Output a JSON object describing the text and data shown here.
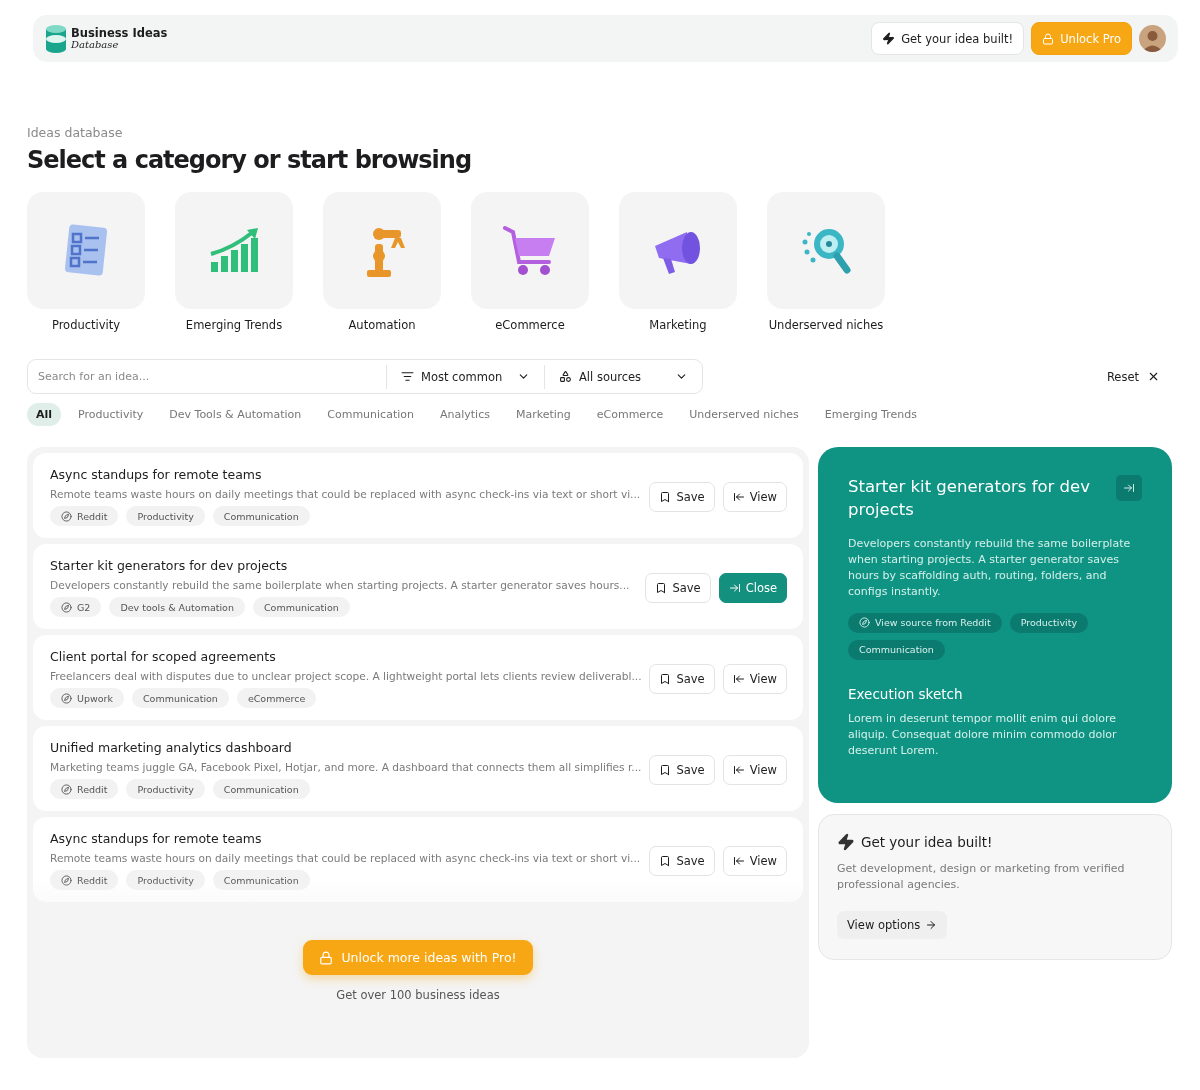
{
  "header": {
    "logo_title": "Business Ideas",
    "logo_subtitle": "Database",
    "build_button": "Get your idea built!",
    "pro_button": "Unlock Pro"
  },
  "eyebrow": "Ideas database",
  "title": "Select a category or start browsing",
  "categories": [
    {
      "label": "Productivity",
      "kind": "checklist"
    },
    {
      "label": "Emerging Trends",
      "kind": "chart"
    },
    {
      "label": "Automation",
      "kind": "robot"
    },
    {
      "label": "eCommerce",
      "kind": "cart"
    },
    {
      "label": "Marketing",
      "kind": "megaphone"
    },
    {
      "label": "Underserved niches",
      "kind": "magnifier"
    }
  ],
  "search": {
    "placeholder": "Search for an idea..."
  },
  "sort": "Most common",
  "sources": "All sources",
  "reset": "Reset",
  "filters": [
    {
      "label": "All",
      "selected": true
    },
    {
      "label": "Productivity",
      "selected": false
    },
    {
      "label": "Dev Tools & Automation",
      "selected": false
    },
    {
      "label": "Communication",
      "selected": false
    },
    {
      "label": "Analytics",
      "selected": false
    },
    {
      "label": "Marketing",
      "selected": false
    },
    {
      "label": "eCommerce",
      "selected": false
    },
    {
      "label": "Underserved niches",
      "selected": false
    },
    {
      "label": "Emerging Trends",
      "selected": false
    }
  ],
  "ideas": [
    {
      "title": "Async standups for remote teams",
      "description": "Remote teams waste hours on daily meetings that could be replaced with async check-ins via text or short vi...",
      "tags": [
        {
          "label": "Reddit",
          "kind": "source"
        },
        {
          "label": "Productivity",
          "kind": "topic"
        },
        {
          "label": "Communication",
          "kind": "topic"
        }
      ],
      "save": "Save",
      "action": "View",
      "selected": false
    },
    {
      "title": "Starter kit generators for dev projects",
      "description": "Developers constantly rebuild the same boilerplate when starting projects. A starter generator saves hours...",
      "tags": [
        {
          "label": "G2",
          "kind": "source"
        },
        {
          "label": "Dev tools & Automation",
          "kind": "topic"
        },
        {
          "label": "Communication",
          "kind": "topic"
        }
      ],
      "save": "Save",
      "action": "Close",
      "selected": true
    },
    {
      "title": "Client portal for scoped agreements",
      "description": "Freelancers deal with disputes due to unclear project scope. A lightweight portal lets clients review deliverabl...",
      "tags": [
        {
          "label": "Upwork",
          "kind": "source"
        },
        {
          "label": "Communication",
          "kind": "topic"
        },
        {
          "label": "eCommerce",
          "kind": "topic"
        }
      ],
      "save": "Save",
      "action": "View",
      "selected": false
    },
    {
      "title": "Unified marketing analytics dashboard",
      "description": "Marketing teams juggle GA, Facebook Pixel, Hotjar, and more. A dashboard that connects them all simplifies r...",
      "tags": [
        {
          "label": "Reddit",
          "kind": "source"
        },
        {
          "label": "Productivity",
          "kind": "topic"
        },
        {
          "label": "Communication",
          "kind": "topic"
        }
      ],
      "save": "Save",
      "action": "View",
      "selected": false
    },
    {
      "title": "Async standups for remote teams",
      "description": "Remote teams waste hours on daily meetings that could be replaced with async check-ins via text or short vi...",
      "tags": [
        {
          "label": "Reddit",
          "kind": "source"
        },
        {
          "label": "Productivity",
          "kind": "topic"
        },
        {
          "label": "Communication",
          "kind": "topic"
        }
      ],
      "save": "Save",
      "action": "View",
      "selected": false
    }
  ],
  "unlock": {
    "button": "Unlock more ideas with Pro!",
    "caption": "Get over 100 business ideas"
  },
  "detail": {
    "title": "Starter kit generators for dev projects",
    "description": "Developers constantly rebuild the same boilerplate when starting projects. A starter generator saves hours by scaffolding auth, routing, folders, and configs instantly.",
    "tags": [
      {
        "label": "View source from Reddit",
        "kind": "source"
      },
      {
        "label": "Productivity",
        "kind": "topic"
      },
      {
        "label": "Communication",
        "kind": "topic"
      }
    ],
    "section_title": "Execution sketch",
    "section_text": "Lorem in deserunt tempor mollit enim qui dolore aliquip. Consequat dolore minim commodo dolor deserunt Lorem."
  },
  "promo": {
    "title": "Get your idea built!",
    "text": "Get development, design or marketing from verified professional agencies.",
    "button": "View options"
  }
}
